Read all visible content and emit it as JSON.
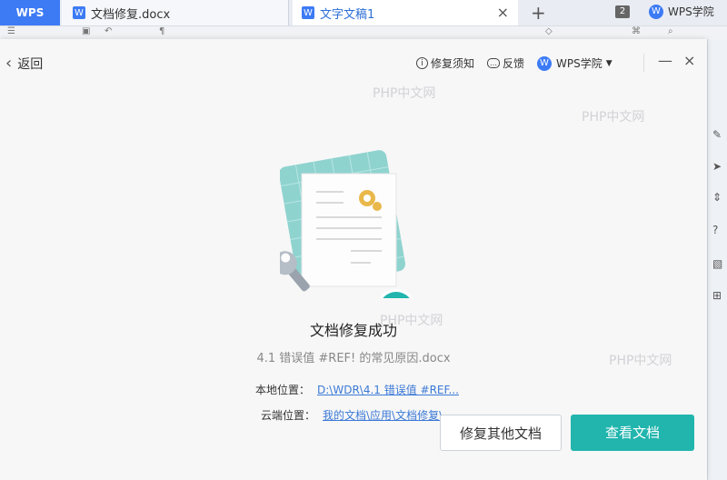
{
  "tabs": {
    "wps_label": "WPS",
    "doc1_label": "文档修复.docx",
    "doc1_icon": "W",
    "doc2_label": "文字文稿1",
    "doc2_icon": "W",
    "add_label": "+",
    "close_label": "×",
    "count": "2",
    "college_label": "WPS学院",
    "college_icon": "W"
  },
  "dialog": {
    "back_label": "返回",
    "notice_label": "修复须知",
    "feedback_label": "反馈",
    "college_label": "WPS学院",
    "minimize_label": "—",
    "close_label": "×"
  },
  "result": {
    "title": "文档修复成功",
    "filename": "4.1 错误值 #REF! 的常见原因.docx",
    "local_label": "本地位置：",
    "local_path": "D:\\WDR\\4.1 错误值 #REF...",
    "cloud_label": "云端位置：",
    "cloud_path": "我的文档\\应用\\文档修复\\"
  },
  "buttons": {
    "repair_other": "修复其他文档",
    "view_doc": "查看文档"
  },
  "watermark": "PHP中文网",
  "colors": {
    "accent": "#21b5ad",
    "brand": "#3d7bf5",
    "link": "#3b79d6"
  }
}
